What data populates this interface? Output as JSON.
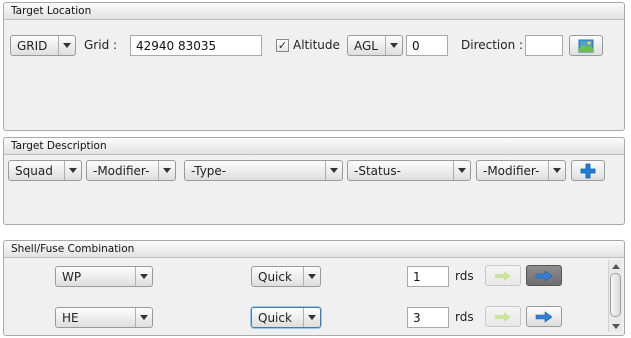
{
  "target_location": {
    "title": "Target Location",
    "coord_type": "GRID",
    "grid_label": "Grid :",
    "grid_value": "42940 83035",
    "altitude_checked": true,
    "altitude_label": "Altitude",
    "altitude_ref": "AGL",
    "altitude_value": "0",
    "direction_label": "Direction :",
    "direction_value": "",
    "map_button_icon": "map-picker-icon"
  },
  "target_description": {
    "title": "Target Description",
    "size": "Squad",
    "modifier1": "-Modifier-",
    "type": "-Type-",
    "status": "-Status-",
    "modifier2": "-Modifier-",
    "add_button_icon": "plus-icon"
  },
  "shell_fuse": {
    "title": "Shell/Fuse Combination",
    "rows": [
      {
        "shell": "WP",
        "fuse": "Quick",
        "rounds": "1",
        "rds_label": "rds"
      },
      {
        "shell": "HE",
        "fuse": "Quick",
        "rounds": "3",
        "rds_label": "rds"
      }
    ]
  },
  "colors": {
    "accent_blue": "#2f7fd6",
    "plus_blue": "#1e7ed8",
    "disabled_arrow": "#c9e59a"
  }
}
